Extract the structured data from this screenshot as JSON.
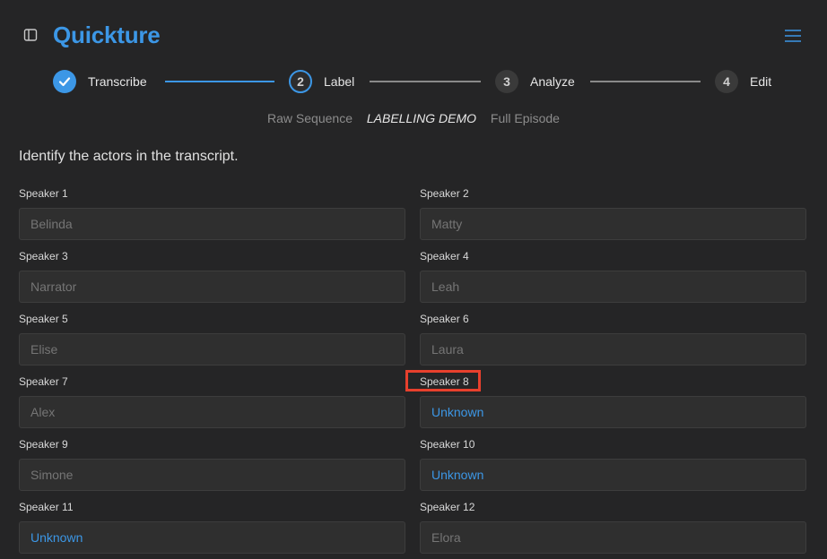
{
  "app": {
    "title": "Quickture"
  },
  "stepper": {
    "steps": [
      {
        "label": "Transcribe",
        "number": "",
        "state": "done"
      },
      {
        "label": "Label",
        "number": "2",
        "state": "active"
      },
      {
        "label": "Analyze",
        "number": "3",
        "state": "todo"
      },
      {
        "label": "Edit",
        "number": "4",
        "state": "todo"
      }
    ]
  },
  "breadcrumbs": {
    "items": [
      "Raw Sequence",
      "LABELLING DEMO",
      "Full Episode"
    ],
    "current_index": 1
  },
  "instruction": "Identify the actors in the transcript.",
  "speakers": [
    {
      "label": "Speaker 1",
      "value": "Belinda"
    },
    {
      "label": "Speaker 2",
      "value": "Matty"
    },
    {
      "label": "Speaker 3",
      "value": "Narrator"
    },
    {
      "label": "Speaker 4",
      "value": "Leah"
    },
    {
      "label": "Speaker 5",
      "value": "Elise"
    },
    {
      "label": "Speaker 6",
      "value": "Laura"
    },
    {
      "label": "Speaker 7",
      "value": "Alex"
    },
    {
      "label": "Speaker 8",
      "value": "Unknown"
    },
    {
      "label": "Speaker 9",
      "value": "Simone"
    },
    {
      "label": "Speaker 10",
      "value": "Unknown"
    },
    {
      "label": "Speaker 11",
      "value": "Unknown"
    },
    {
      "label": "Speaker 12",
      "value": "Elora"
    }
  ],
  "colors": {
    "accent": "#3c97e6",
    "highlight": "#e8402d",
    "background": "#252526"
  },
  "icons": {
    "sidebar_toggle": "sidebar-toggle-icon",
    "menu": "hamburger-menu-icon",
    "done_step": "checkmark-icon"
  }
}
